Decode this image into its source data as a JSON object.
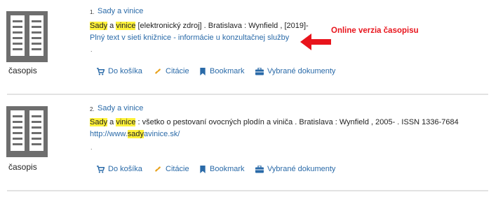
{
  "results": [
    {
      "number": "1.",
      "title": "Sady a vinice",
      "line_parts": [
        "Sady",
        " a ",
        "vinice",
        " [elektronický zdroj] . Bratislava :  Wynfield , [2019]-"
      ],
      "link": "Plný text v sieti knižnice - informácie u konzultačnej služby",
      "dot": ".",
      "thumb_label": "časopis",
      "actions": [
        "Do košíka",
        "Citácie",
        "Bookmark",
        "Vybrané dokumenty"
      ]
    },
    {
      "number": "2.",
      "title": "Sady a vinice",
      "line_parts": [
        "Sady",
        " a ",
        "vinice",
        " : všetko o pestovaní ovocných plodín a viniča . Bratislava :  Wynfield , 2005- . ISSN 1336-7684"
      ],
      "link_parts": [
        "http://www.",
        "sady",
        "avinice.sk/"
      ],
      "dot": ".",
      "thumb_label": "časopis",
      "actions": [
        "Do košíka",
        "Citácie",
        "Bookmark",
        "Vybrané dokumenty"
      ]
    }
  ],
  "annotation": "Online verzia časopisu",
  "colors": {
    "link": "#2a6aa8",
    "highlight": "#fff23a",
    "annotation": "#e8141c",
    "icon_gray": "#6e6e6e"
  },
  "icons": {
    "thumb": "book-icon",
    "cart": "cart-icon",
    "cite": "cite-icon",
    "bookmark": "bookmark-icon",
    "selected": "briefcase-icon"
  }
}
